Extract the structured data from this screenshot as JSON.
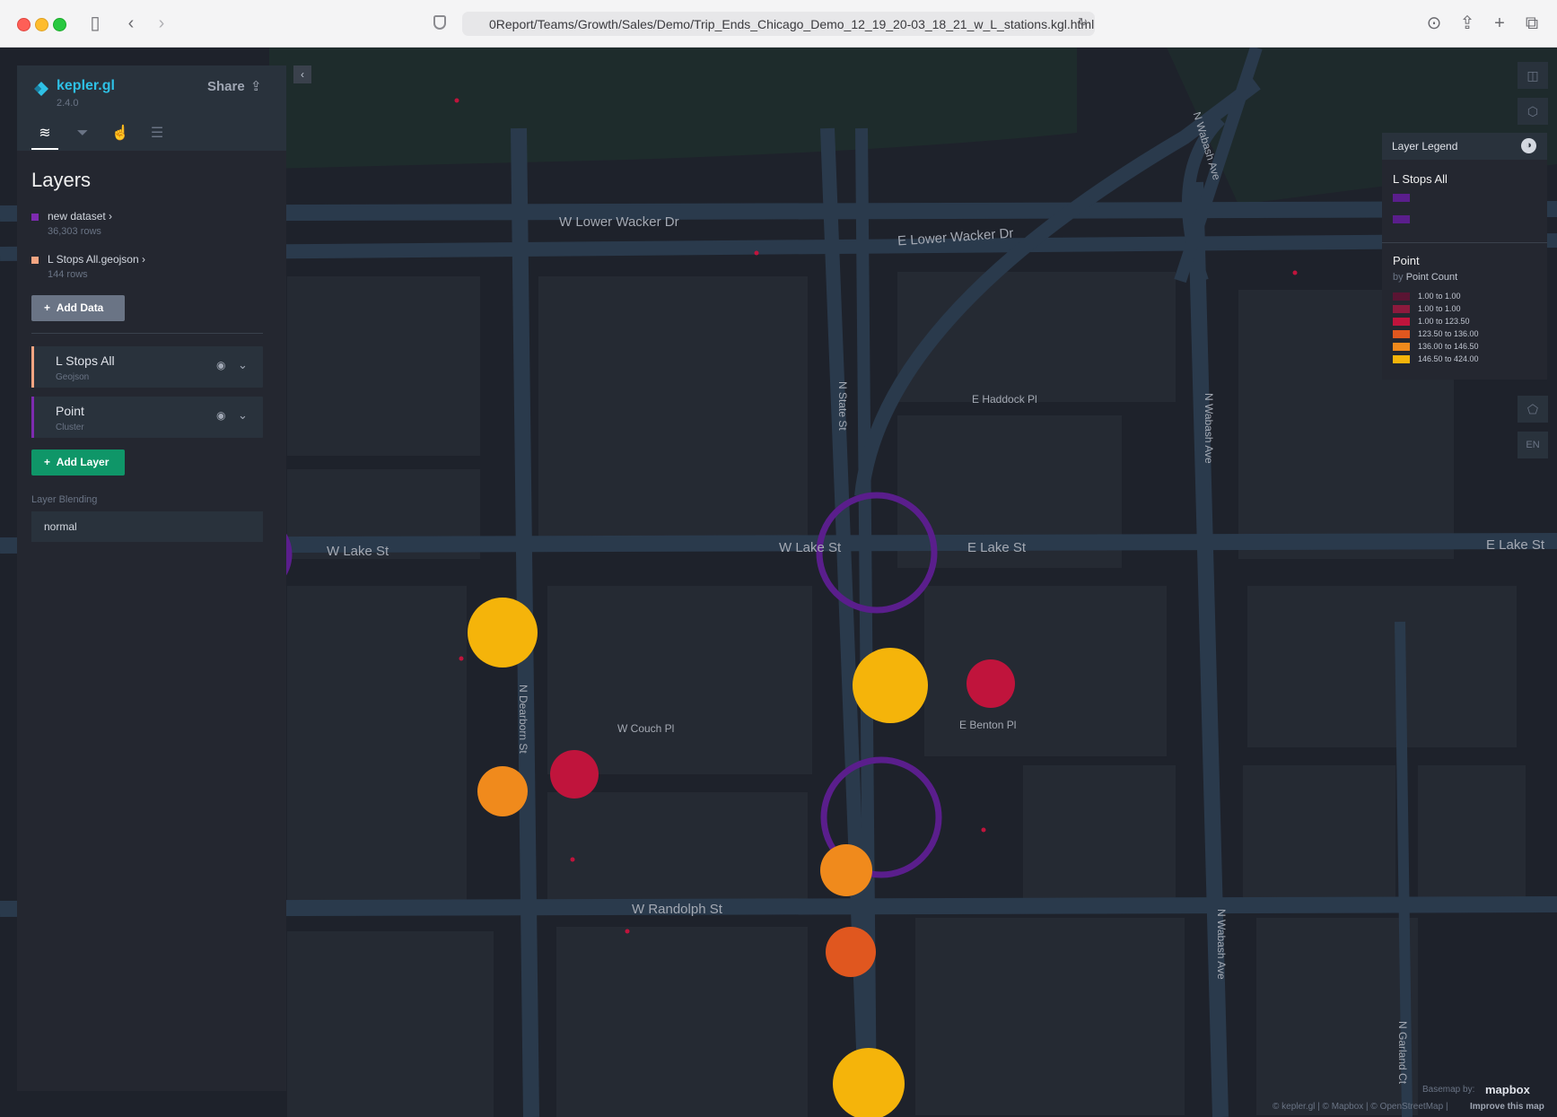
{
  "browser": {
    "url": "0Report/Teams/Growth/Sales/Demo/Trip_Ends_Chicago_Demo_12_19_20-03_18_21_w_L_stations.kgl.html"
  },
  "app": {
    "name": "kepler.gl",
    "version": "2.4.0",
    "share_label": "Share",
    "tabs": [
      "layers-icon",
      "filter-icon",
      "interaction-icon",
      "settings-icon"
    ]
  },
  "panel": {
    "title": "Layers",
    "datasets": [
      {
        "name": "new dataset",
        "rows": "36,303 rows",
        "color": "#7e2bb0"
      },
      {
        "name": "L Stops All.geojson",
        "rows": "144 rows",
        "color": "#f4a582"
      }
    ],
    "add_data_label": "Add Data",
    "layers": [
      {
        "name": "L Stops All",
        "type": "Geojson",
        "color": "#f4a582"
      },
      {
        "name": "Point",
        "type": "Cluster",
        "color": "#7e2bb0"
      }
    ],
    "add_layer_label": "Add Layer",
    "blending_label": "Layer Blending",
    "blending_value": "normal"
  },
  "legend": {
    "title": "Layer Legend",
    "layers": [
      {
        "name": "L Stops All",
        "swatches": [
          "#5a1e8c",
          "#5a1e8c"
        ]
      },
      {
        "name": "Point",
        "by_prefix": "by",
        "by_field": "Point Count",
        "rows": [
          {
            "label": "1.00 to 1.00",
            "color": "#5a1533"
          },
          {
            "label": "1.00 to 1.00",
            "color": "#8c1a3d"
          },
          {
            "label": "1.00 to 123.50",
            "color": "#c0143c"
          },
          {
            "label": "123.50 to 136.00",
            "color": "#e0571f"
          },
          {
            "label": "136.00 to 146.50",
            "color": "#f08a1c"
          },
          {
            "label": "146.50 to 424.00",
            "color": "#f5b40a"
          }
        ]
      }
    ]
  },
  "map": {
    "streets": {
      "w_lower_wacker": "W Lower Wacker Dr",
      "e_lower_wacker": "E Lower Wacker Dr",
      "n_wabash_top": "N Wabash Ave",
      "n_state": "N State St",
      "e_haddock": "E Haddock Pl",
      "n_wabash_mid": "N Wabash Ave",
      "w_lake_left": "W Lake St",
      "w_lake_mid": "W Lake St",
      "e_lake_mid": "E Lake St",
      "e_lake_right": "E Lake St",
      "n_dearborn": "N Dearborn St",
      "w_couch": "W Couch Pl",
      "e_benton": "E Benton Pl",
      "w_randolph": "W Randolph St",
      "n_wabash_bottom": "N Wabash Ave",
      "n_garland": "N Garland Ct"
    },
    "controls": [
      "split-map-icon",
      "3d-view-icon",
      "draw-polygon-icon"
    ],
    "locale": "EN",
    "attribution": {
      "basemap_by": "Basemap by:",
      "mapbox": "mapbox",
      "credits": "© kepler.gl | © Mapbox | © OpenStreetMap |",
      "improve": "Improve this map"
    }
  }
}
